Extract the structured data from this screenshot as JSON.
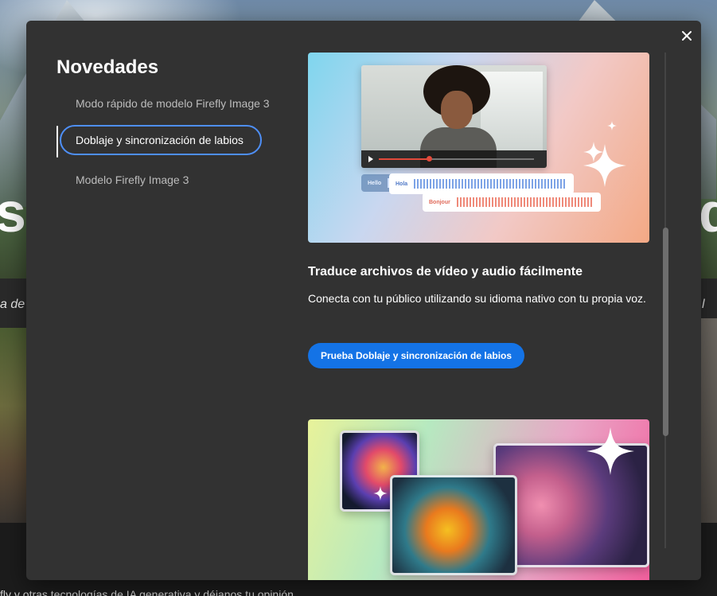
{
  "background": {
    "headline_left": "su",
    "headline_right": "d",
    "line_left": "a de",
    "line_right": "l",
    "footer_text": "fly y otras tecnologías de IA generativa y déjanos tu opinión"
  },
  "modal": {
    "title": "Novedades",
    "close_label": "×",
    "nav": [
      {
        "label": "Modo rápido de modelo Firefly Image 3",
        "active": false
      },
      {
        "label": "Doblaje y sincronización de labios",
        "active": true
      },
      {
        "label": "Modelo Firefly Image 3",
        "active": false
      }
    ],
    "feature": {
      "title": "Traduce archivos de vídeo y audio fácilmente",
      "description": "Conecta con tu público utilizando su idioma nativo con tu propia voz.",
      "cta_label": "Prueba Doblaje y sincronización de labios",
      "strip_labels": [
        "Hello",
        "Hola",
        "Bonjour"
      ]
    }
  },
  "colors": {
    "modal_bg": "#323232",
    "accent_blue": "#1473e6",
    "focus_ring": "#4e8ff7"
  },
  "icons": {
    "close": "close-icon",
    "play": "play-icon",
    "sparkle": "sparkle-icon"
  }
}
